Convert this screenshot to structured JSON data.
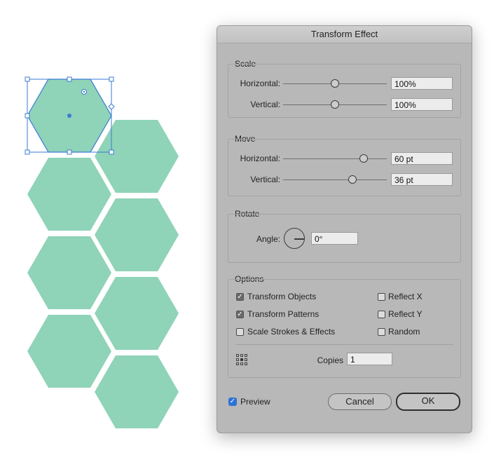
{
  "colors": {
    "hex_fill": "#8fd3b8",
    "selection": "#3a7bd5",
    "dialog_bg": "#b8b8b8"
  },
  "dialog": {
    "title": "Transform Effect"
  },
  "scale": {
    "title": "Scale",
    "horizontal": {
      "label": "Horizontal:",
      "value": "100%",
      "slider_fraction": 0.5
    },
    "vertical": {
      "label": "Vertical:",
      "value": "100%",
      "slider_fraction": 0.5
    }
  },
  "move": {
    "title": "Move",
    "horizontal": {
      "label": "Horizontal:",
      "value": "60 pt",
      "slider_fraction": 0.78
    },
    "vertical": {
      "label": "Vertical:",
      "value": "36 pt",
      "slider_fraction": 0.67
    }
  },
  "rotate": {
    "title": "Rotate",
    "angle_label": "Angle:",
    "angle_value": "0°"
  },
  "options": {
    "title": "Options",
    "transform_objects": {
      "label": "Transform Objects",
      "checked": true
    },
    "transform_patterns": {
      "label": "Transform Patterns",
      "checked": true
    },
    "scale_strokes": {
      "label": "Scale Strokes & Effects",
      "checked": false
    },
    "reflect_x": {
      "label": "Reflect X",
      "checked": false
    },
    "reflect_y": {
      "label": "Reflect Y",
      "checked": false
    },
    "random": {
      "label": "Random",
      "checked": false
    },
    "copies_label": "Copies",
    "copies_value": "1"
  },
  "footer": {
    "preview": {
      "label": "Preview",
      "checked": true
    },
    "cancel_label": "Cancel",
    "ok_label": "OK"
  }
}
